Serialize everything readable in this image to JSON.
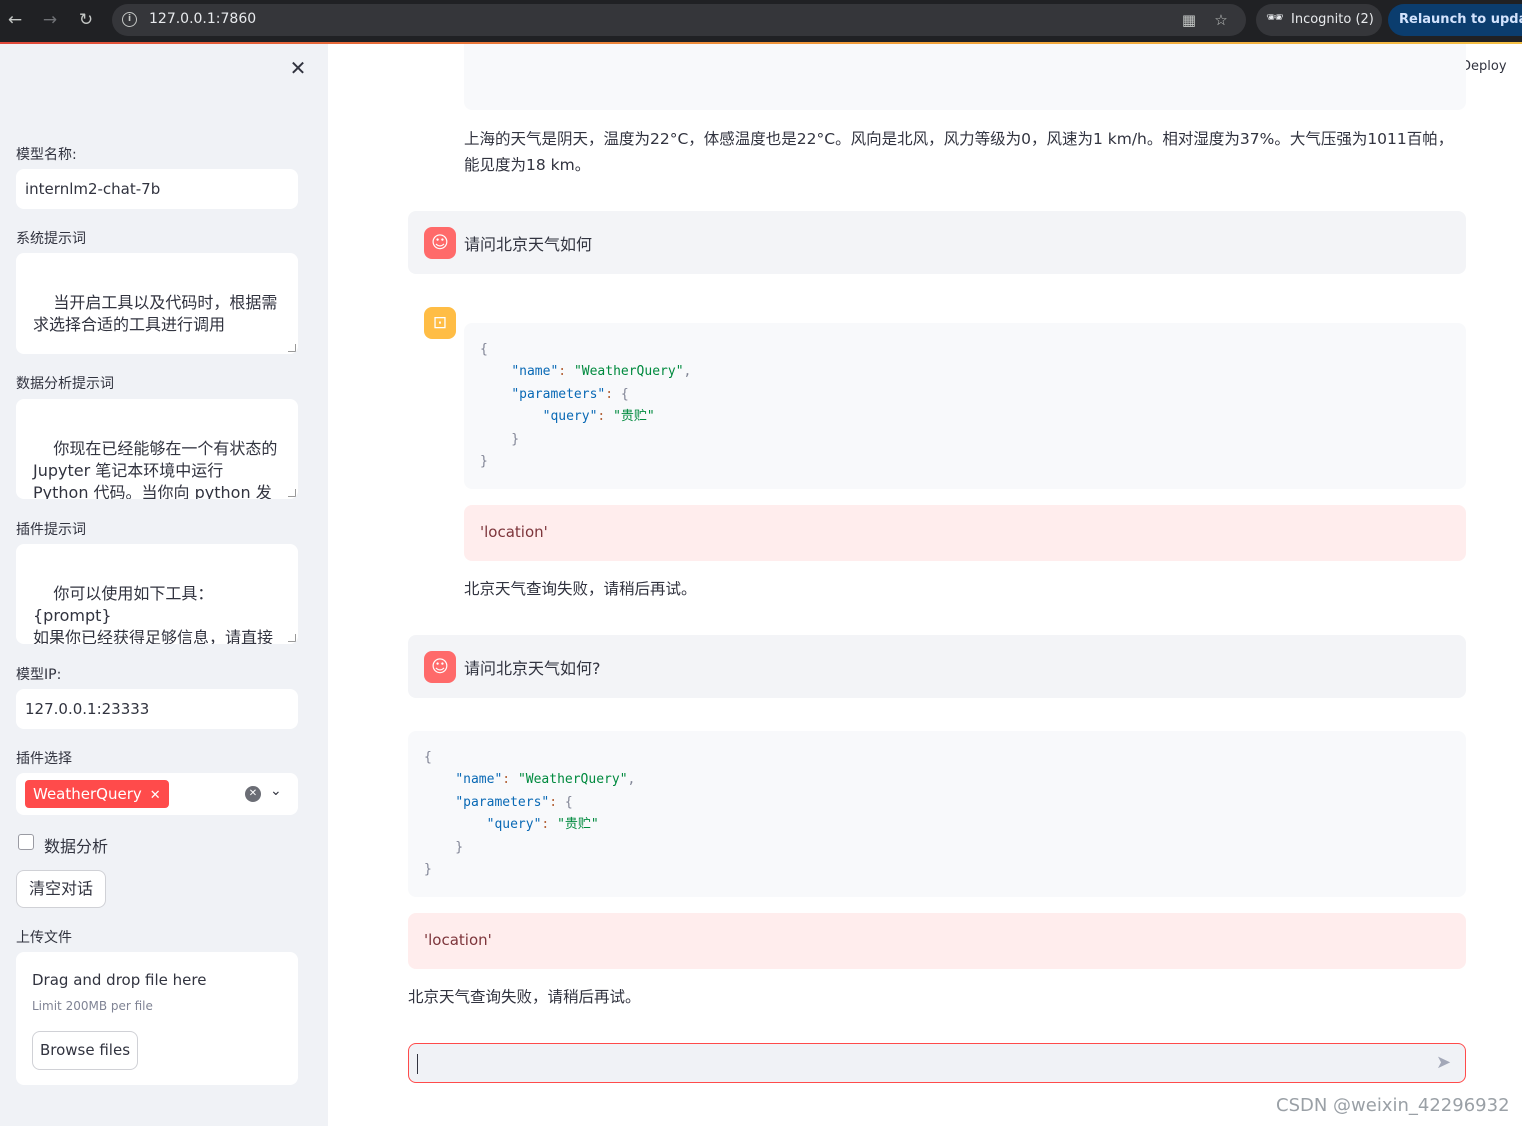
{
  "browser": {
    "url": "127.0.0.1:7860",
    "incognito_label": "Incognito (2)",
    "relaunch_label": "Relaunch to update"
  },
  "sidebar": {
    "model_name_label": "模型名称:",
    "model_name_value": "internlm2-chat-7b",
    "system_prompt_label": "系统提示词",
    "system_prompt_value": "当开启工具以及代码时，根据需求选择合适的工具进行调用",
    "data_prompt_label": "数据分析提示词",
    "data_prompt_value": "你现在已经能够在一个有状态的 Jupyter 笔记本环境中运行 Python 代码。当你向 python 发送含有 Python 代码的消息时，它将在该",
    "plugin_prompt_label": "插件提示词",
    "plugin_prompt_value": "你可以使用如下工具：\n{prompt}\n如果你已经获得足够信息，请直接给出答案. 避免不必要的工具调用!",
    "model_ip_label": "模型IP:",
    "model_ip_value": "127.0.0.1:23333",
    "plugin_select_label": "插件选择",
    "plugin_selected": [
      "WeatherQuery"
    ],
    "data_analysis_label": "数据分析",
    "data_analysis_checked": false,
    "clear_button": "清空对话",
    "upload_label": "上传文件",
    "upload_title": "Drag and drop file here",
    "upload_limit": "Limit 200MB per file",
    "browse_button": "Browse files"
  },
  "main": {
    "deploy_label": "Deploy",
    "messages": [
      {
        "role": "assistant",
        "text": "上海的天气是阴天，温度为22°C，体感温度也是22°C。风向是北风，风力等级为0，风速为1 km/h。相对湿度为37%。大气压强为1011百帕，能见度为18 km。"
      },
      {
        "role": "user",
        "text": "请问北京天气如何"
      },
      {
        "role": "assistant",
        "code": {
          "name": "WeatherQuery",
          "query": "贵贮"
        },
        "error": "'location'",
        "text": "北京天气查询失败，请稍后再试。"
      },
      {
        "role": "user",
        "text": "请问北京天气如何?"
      },
      {
        "role": "assistant",
        "code": {
          "name": "WeatherQuery",
          "query": "贵贮"
        },
        "error": "'location'",
        "text": "北京天气查询失败，请稍后再试。"
      }
    ],
    "chat_input_value": ""
  },
  "watermark": "CSDN @weixin_42296932",
  "colors": {
    "accent": "#ff4b4b",
    "sidebar_bg": "#f0f2f6",
    "user_avatar": "#ff6a6a",
    "bot_avatar": "#ffbd45"
  }
}
